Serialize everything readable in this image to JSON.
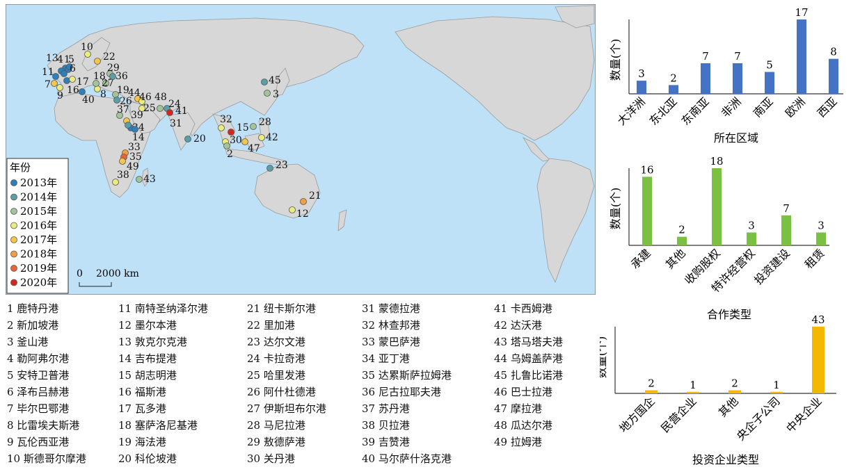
{
  "map": {
    "legend_title": "年份",
    "legend_items": [
      {
        "label": "2013年",
        "color": "#2f7fb8"
      },
      {
        "label": "2014年",
        "color": "#5b9ea6"
      },
      {
        "label": "2015年",
        "color": "#a3c49a"
      },
      {
        "label": "2016年",
        "color": "#e9ec7e"
      },
      {
        "label": "2017年",
        "color": "#f6c64a"
      },
      {
        "label": "2018年",
        "color": "#f0a043"
      },
      {
        "label": "2019年",
        "color": "#e8643a"
      },
      {
        "label": "2020年",
        "color": "#d7261d"
      }
    ],
    "scale_zero": "0",
    "scale_label": "2000 km",
    "ocean_color": "#bfe1f7",
    "land_color": "#d7d7d7"
  },
  "ports": [
    {
      "num": "1",
      "name": "鹿特丹港"
    },
    {
      "num": "2",
      "name": "新加坡港"
    },
    {
      "num": "3",
      "name": "釜山港"
    },
    {
      "num": "4",
      "name": "勒阿弗尔港"
    },
    {
      "num": "5",
      "name": "安特卫普港"
    },
    {
      "num": "6",
      "name": "泽布吕赫港"
    },
    {
      "num": "7",
      "name": "毕尔巴鄂港"
    },
    {
      "num": "8",
      "name": "比雷埃夫斯港"
    },
    {
      "num": "9",
      "name": "瓦伦西亚港"
    },
    {
      "num": "10",
      "name": "斯德哥尔摩港"
    },
    {
      "num": "11",
      "name": "南特圣纳泽尔港"
    },
    {
      "num": "12",
      "name": "墨尔本港"
    },
    {
      "num": "13",
      "name": "敦克尔克港"
    },
    {
      "num": "14",
      "name": "吉布提港"
    },
    {
      "num": "15",
      "name": "胡志明港"
    },
    {
      "num": "16",
      "name": "福斯港"
    },
    {
      "num": "17",
      "name": "瓦多港"
    },
    {
      "num": "18",
      "name": "塞萨洛尼基港"
    },
    {
      "num": "19",
      "name": "海法港"
    },
    {
      "num": "20",
      "name": "科伦坡港"
    },
    {
      "num": "21",
      "name": "纽卡斯尔港"
    },
    {
      "num": "22",
      "name": "里加港"
    },
    {
      "num": "23",
      "name": "达尔文港"
    },
    {
      "num": "24",
      "name": "卡拉奇港"
    },
    {
      "num": "25",
      "name": "哈里发港"
    },
    {
      "num": "26",
      "name": "阿什杜德港"
    },
    {
      "num": "27",
      "name": "伊斯坦布尔港"
    },
    {
      "num": "28",
      "name": "马尼拉港"
    },
    {
      "num": "29",
      "name": "敖德萨港"
    },
    {
      "num": "30",
      "name": "关丹港"
    },
    {
      "num": "31",
      "name": "蒙德拉港"
    },
    {
      "num": "32",
      "name": "林查邦港"
    },
    {
      "num": "33",
      "name": "蒙巴萨港"
    },
    {
      "num": "34",
      "name": "亚丁港"
    },
    {
      "num": "35",
      "name": "达累斯萨拉姆港"
    },
    {
      "num": "36",
      "name": "尼古拉耶夫港"
    },
    {
      "num": "37",
      "name": "苏丹港"
    },
    {
      "num": "38",
      "name": "贝拉港"
    },
    {
      "num": "39",
      "name": "吉赞港"
    },
    {
      "num": "40",
      "name": "马尔萨什洛克港"
    },
    {
      "num": "41",
      "name": "卡西姆港"
    },
    {
      "num": "42",
      "name": "达沃港"
    },
    {
      "num": "43",
      "name": "塔马塔夫港"
    },
    {
      "num": "44",
      "name": "乌姆盖萨港"
    },
    {
      "num": "45",
      "name": "扎鲁比诺港"
    },
    {
      "num": "46",
      "name": "巴士拉港"
    },
    {
      "num": "47",
      "name": "摩拉港"
    },
    {
      "num": "48",
      "name": "瓜达尔港"
    },
    {
      "num": "49",
      "name": "拉姆港"
    }
  ],
  "chart_data": [
    {
      "type": "bar",
      "xlabel": "所在区域",
      "ylabel": "数量(个)",
      "categories": [
        "大洋洲",
        "东北亚",
        "东南亚",
        "非洲",
        "南亚",
        "欧洲",
        "西亚"
      ],
      "values": [
        3,
        2,
        7,
        7,
        5,
        17,
        8
      ],
      "color": "#4472c4",
      "ylim": [
        0,
        17
      ]
    },
    {
      "type": "bar",
      "xlabel": "合作类型",
      "ylabel": "数量(个)",
      "categories": [
        "承建",
        "其他",
        "收购股权",
        "特许经营权",
        "投资建设",
        "租赁"
      ],
      "values": [
        16,
        2,
        18,
        3,
        7,
        3
      ],
      "color": "#7ac143",
      "ylim": [
        0,
        18
      ]
    },
    {
      "type": "bar",
      "xlabel": "投资企业类型",
      "ylabel": "数量(个)",
      "categories": [
        "地方国企",
        "民营企业",
        "其他",
        "央企子公司",
        "中央企业"
      ],
      "values": [
        2,
        1,
        2,
        1,
        43
      ],
      "color": "#f5b800",
      "ylim": [
        0,
        43
      ]
    }
  ]
}
